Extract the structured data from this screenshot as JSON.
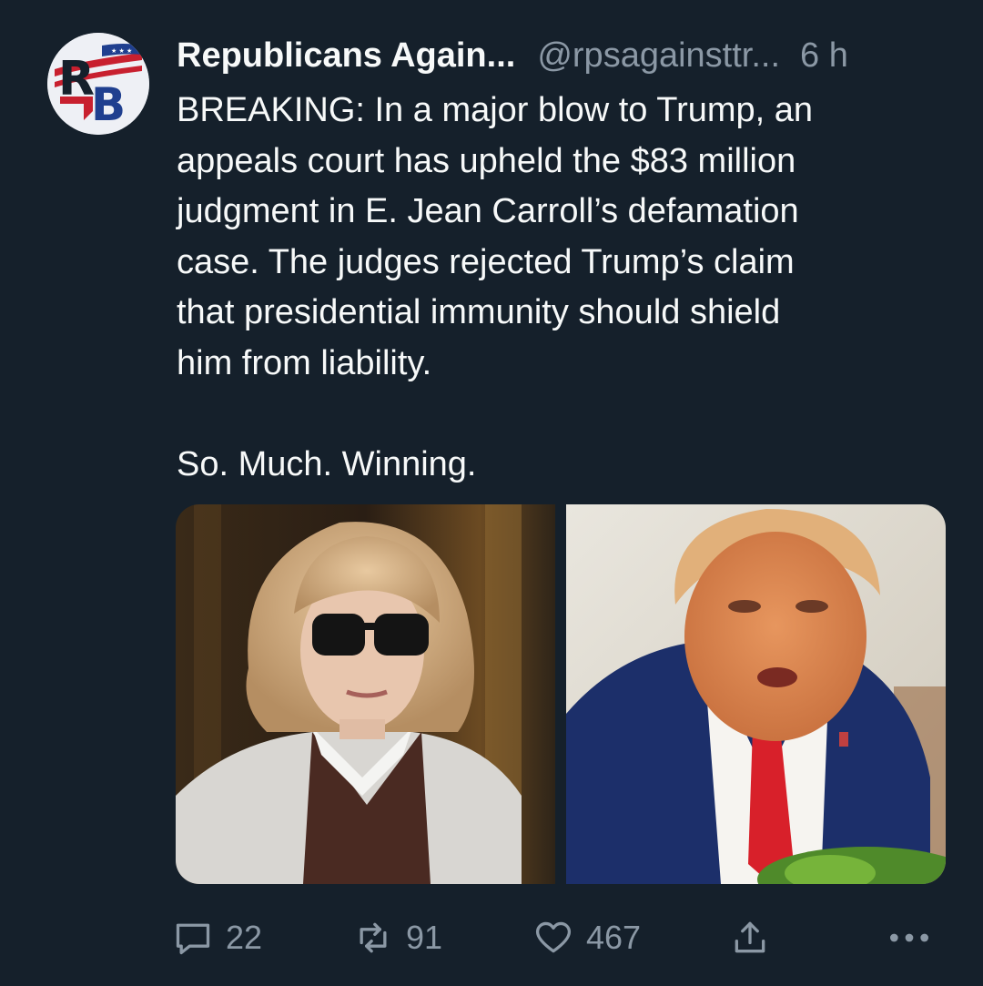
{
  "tweet": {
    "author": {
      "display_name": "Republicans Again...",
      "handle": "@rpsagainsttr...",
      "avatar_initials": "RB"
    },
    "time": "6 h",
    "text": "BREAKING: In a major blow to Trump, an\nappeals court has upheld the $83 million\njudgment in E. Jean Carroll’s defamation\ncase. The judges rejected Trump’s claim\nthat presidential immunity should shield\nhim from liability.\n\nSo. Much. Winning.",
    "media": [
      {
        "icon": "photo-woman-sunglasses"
      },
      {
        "icon": "photo-man-red-tie"
      }
    ]
  },
  "actions": {
    "reply": {
      "icon": "reply-icon",
      "count": "22"
    },
    "retweet": {
      "icon": "retweet-icon",
      "count": "91"
    },
    "like": {
      "icon": "heart-icon",
      "count": "467"
    },
    "share": {
      "icon": "share-icon"
    },
    "more": {
      "icon": "more-icon"
    }
  },
  "colors": {
    "background": "#15202b",
    "text_primary": "#f7f9f9",
    "text_secondary": "#8b98a5",
    "avatar_red": "#c8202f",
    "avatar_blue": "#1f3f8f"
  }
}
